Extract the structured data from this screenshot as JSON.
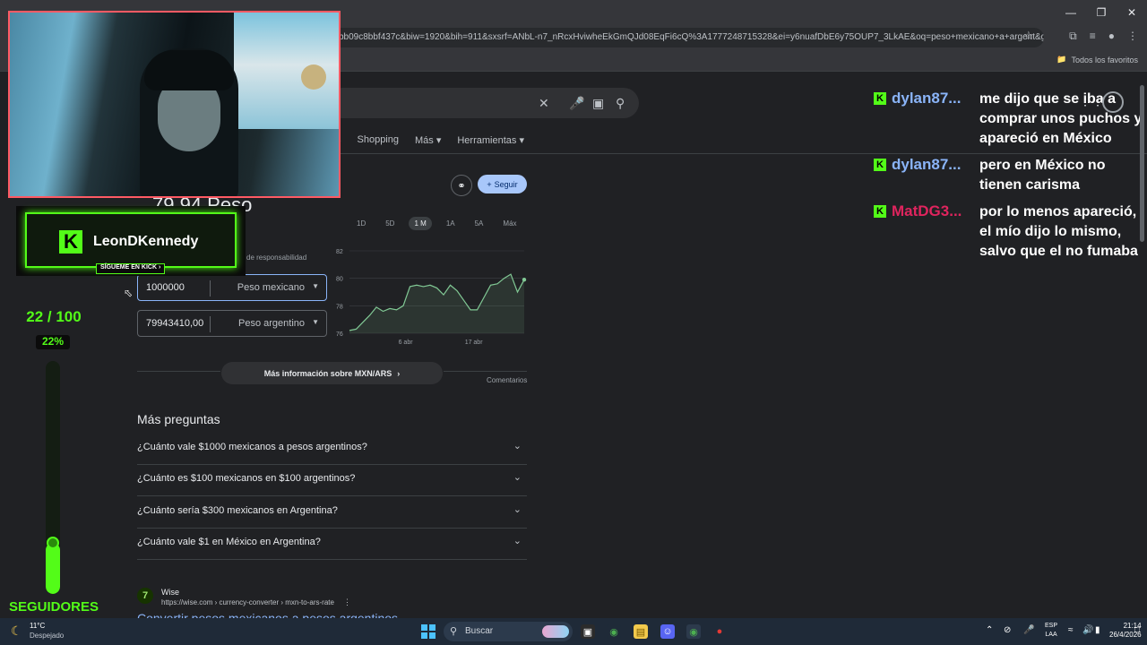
{
  "browser": {
    "url": "bb09c8bbf437c&biw=1920&bih=911&sxsrf=ANbL-n7_nRcxHviwheEkGmQJd08EqFi6cQ%3A1777248715328&ei=y6nuafDbE6y75OUP7_3LkAE&oq=peso+mexicano+a+argent&gs_lp...",
    "bookmarks_label": "Todos los favoritos"
  },
  "search": {
    "tabs": [
      "s",
      "Shopping",
      "Más",
      "Herramientas"
    ]
  },
  "converter": {
    "heading": "79,94 Peso",
    "disclaimer": "de responsabilidad",
    "share_label": "Compartir",
    "follow_label": "Seguir",
    "ranges": [
      "1D",
      "5D",
      "1 M",
      "1A",
      "5A",
      "Máx"
    ],
    "active_range": "1 M",
    "amount_value": "1000000",
    "amount_currency": "Peso mexicano",
    "result_value": "79943410,00",
    "result_currency": "Peso argentino",
    "more_info": "Más información sobre MXN/ARS",
    "comments": "Comentarios"
  },
  "chart_data": {
    "type": "area",
    "x_ticks": [
      "6 abr",
      "17 abr"
    ],
    "yticks": [
      76,
      78,
      80,
      82
    ],
    "ylim": [
      76,
      82
    ],
    "values": [
      76.2,
      76.3,
      76.8,
      77.3,
      77.9,
      77.6,
      77.8,
      77.7,
      78.0,
      79.4,
      79.5,
      79.4,
      79.5,
      79.3,
      78.8,
      79.5,
      79.1,
      78.4,
      77.7,
      77.7,
      78.6,
      79.5,
      79.6,
      80.0,
      80.3,
      79.0,
      79.9
    ]
  },
  "faq": {
    "title": "Más preguntas",
    "questions": [
      "¿Cuánto vale $1000 mexicanos a pesos argentinos?",
      "¿Cuánto es $100 mexicanos en $100 argentinos?",
      "¿Cuánto sería $300 mexicanos en Argentina?",
      "¿Cuánto vale $1 en México en Argentina?"
    ]
  },
  "result_wise": {
    "name": "Wise",
    "url": "https://wise.com › currency-converter › mxn-to-ars-rate",
    "title": "Convertir pesos mexicanos a pesos argentinos"
  },
  "stream": {
    "kick_name": "LeonDKennedy",
    "kick_follow": "SÍGUEME EN KICK ›",
    "goal_count": "22 / 100",
    "goal_percent": "22%",
    "goal_fraction": 0.22,
    "goal_label": "SEGUIDORES",
    "accent": "#53fc18",
    "chat": [
      {
        "user": "dylan87...",
        "color": "#8ab4f8",
        "text": "me dijo que se iba a comprar unos puchos y apareció en México"
      },
      {
        "user": "dylan87...",
        "color": "#8ab4f8",
        "text": "pero en México no tienen carisma"
      },
      {
        "user": "MatDG3...",
        "color": "#e0245e",
        "text": "por lo menos apareció, el mío dijo lo mismo, salvo que el no fumaba"
      }
    ]
  },
  "taskbar": {
    "temperature": "11°C",
    "weather": "Despejado",
    "search_label": "Buscar",
    "lang_top": "ESP",
    "lang_bottom": "LAA",
    "time": "21:14",
    "date": "26/4/2026"
  }
}
